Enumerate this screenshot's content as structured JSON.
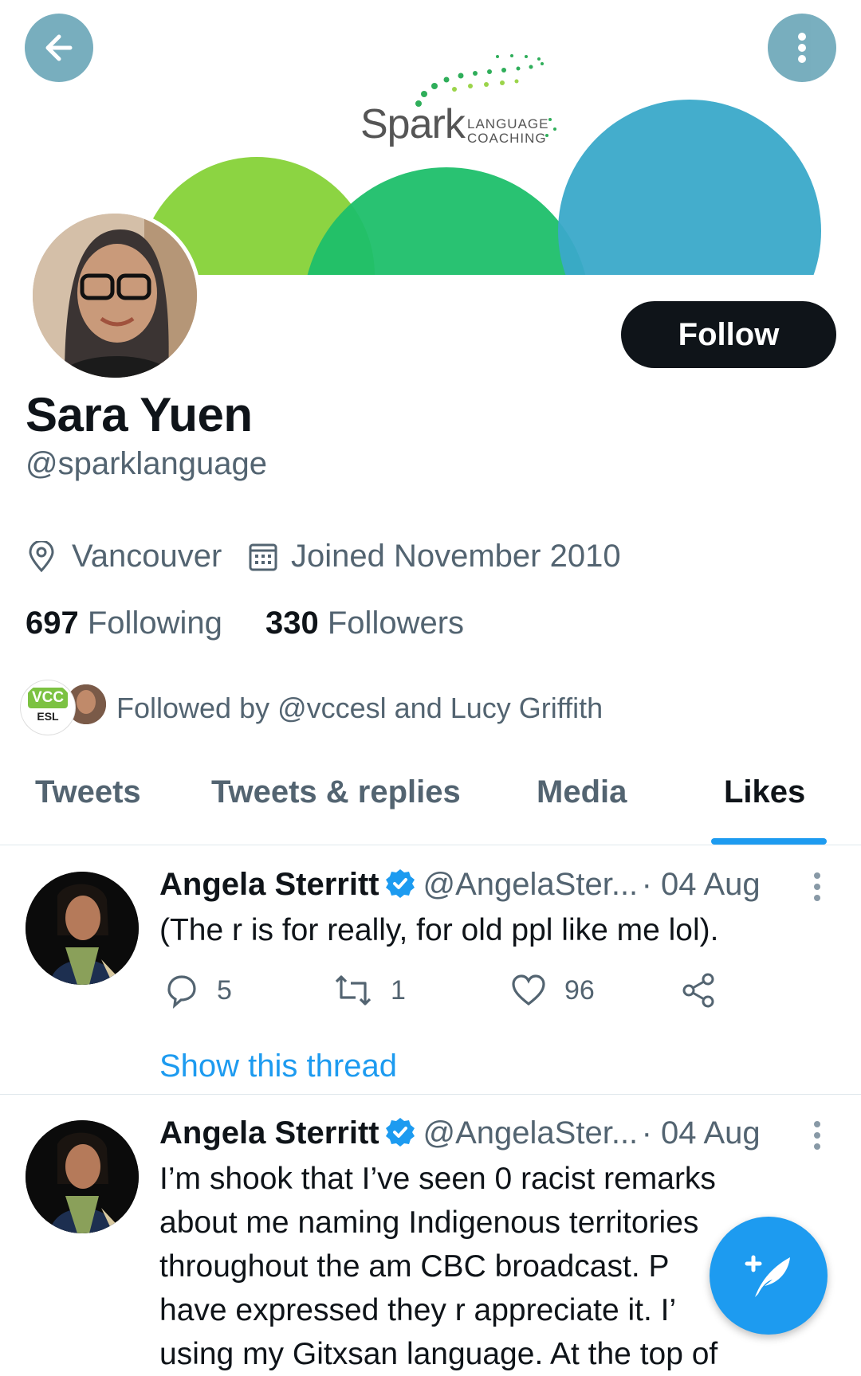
{
  "colors": {
    "accent": "#1d9bf0",
    "follow_bg": "#0f1419",
    "muted": "#536471"
  },
  "banner": {
    "logo_word": "Spark",
    "logo_line1": "LANGUAGE",
    "logo_line2": "COACHING"
  },
  "nav": {
    "back_icon": "arrow-left-icon",
    "more_icon": "more-vertical-icon"
  },
  "profile": {
    "follow_label": "Follow",
    "name": "Sara Yuen",
    "handle": "@sparklanguage",
    "location": "Vancouver",
    "joined": "Joined November 2010",
    "following_count": "697",
    "following_label": "Following",
    "followers_count": "330",
    "followers_label": "Followers",
    "followed_by": "Followed by @vccesl and Lucy Griffith",
    "badge_top": "VCC",
    "badge_bottom": "ESL"
  },
  "tabs": [
    "Tweets",
    "Tweets & replies",
    "Media",
    "Likes"
  ],
  "active_tab": "Likes",
  "tweets": [
    {
      "name": "Angela Sterritt",
      "handle": "@AngelaSter...",
      "date": "· 04 Aug",
      "text": "(The r is for really, for old ppl like me lol).",
      "replies": "5",
      "retweets": "1",
      "likes": "96",
      "show_thread": "Show this thread"
    },
    {
      "name": "Angela Sterritt",
      "handle": "@AngelaSter...",
      "date": "· 04 Aug",
      "text_lines": [
        "I’m shook that I’ve seen 0 racist remarks",
        "about me naming Indigenous territories",
        "throughout the am CBC broadcast. P",
        "have expressed they r appreciate it. I’",
        "using my Gitxsan language. At the top of"
      ]
    }
  ]
}
